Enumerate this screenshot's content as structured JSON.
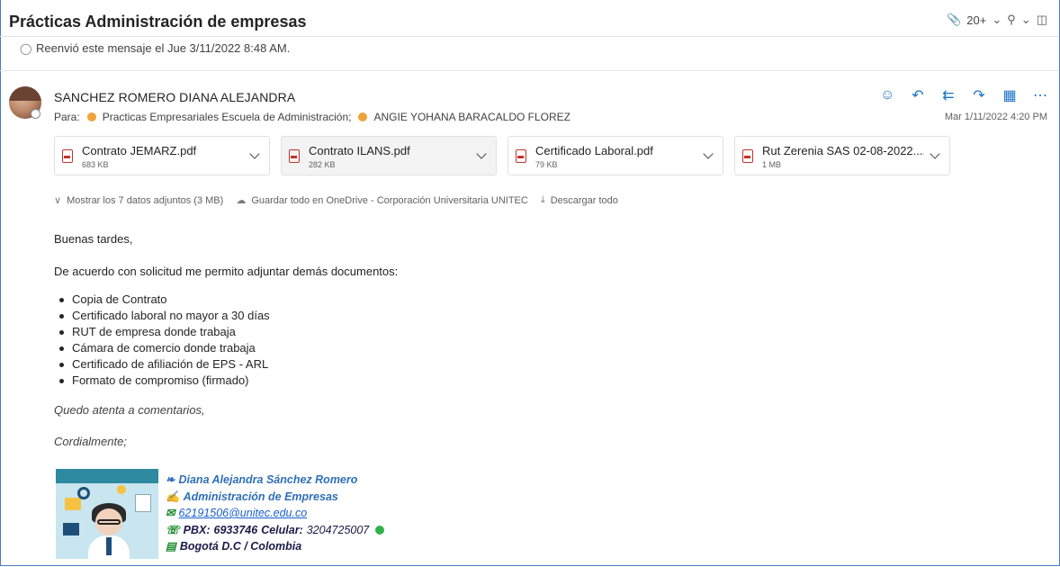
{
  "header": {
    "subject": "Prácticas Administración de empresas",
    "attachment_count": "20+",
    "icons": {
      "clip": "paperclip-icon",
      "zoom": "zoom-icon",
      "popout": "popout-icon"
    }
  },
  "forward_notice": "Reenvió este mensaje el Jue 3/11/2022 8:48 AM.",
  "message": {
    "sender": "SANCHEZ ROMERO DIANA ALEJANDRA",
    "to_label": "Para:",
    "recipients": [
      "Practicas Empresariales Escuela de Administración;",
      "ANGIE YOHANA BARACALDO FLOREZ"
    ],
    "date": "Mar 1/11/2022 4:20 PM",
    "actions": [
      "emoji-icon",
      "reply-icon",
      "reply-all-icon",
      "forward-icon",
      "apps-icon",
      "more-icon"
    ]
  },
  "attachments": [
    {
      "name": "Contrato JEMARZ.pdf",
      "size": "683 KB"
    },
    {
      "name": "Contrato ILANS.pdf",
      "size": "282 KB"
    },
    {
      "name": "Certificado Laboral.pdf",
      "size": "79 KB"
    },
    {
      "name": "Rut Zerenia SAS 02-08-2022....",
      "size": "1 MB"
    }
  ],
  "attachment_links": {
    "show_all": "Mostrar los 7 datos adjuntos (3 MB)",
    "save_onedrive": "Guardar todo en OneDrive - Corporación Universitaria UNITEC",
    "download_all": "Descargar todo"
  },
  "body": {
    "greeting": "Buenas tardes,",
    "intro": "De acuerdo con solicitud me permito adjuntar demás documentos:",
    "items": [
      "Copia de Contrato",
      "Certificado laboral no mayor a 30 días",
      "RUT de empresa donde trabaja",
      "Cámara de comercio donde trabaja",
      "Certificado de afiliación de EPS - ARL",
      "Formato de compromiso (firmado)"
    ],
    "closing": "Quedo atenta a comentarios,",
    "regards": "Cordialmente;"
  },
  "signature": {
    "name": "Diana Alejandra Sánchez Romero",
    "role": "Administración de Empresas",
    "email": "62191506@unitec.edu.co",
    "pbx_label": "PBX:",
    "pbx": "6933746",
    "cell_label": "Celular:",
    "cell": "3204725007",
    "city": "Bogotá D.C / Colombia"
  },
  "colors": {
    "accent": "#1a73c8",
    "presence_dot": "#f0a23a",
    "sig_blue": "#2f6fb8",
    "pdf_red": "#c4342b"
  }
}
